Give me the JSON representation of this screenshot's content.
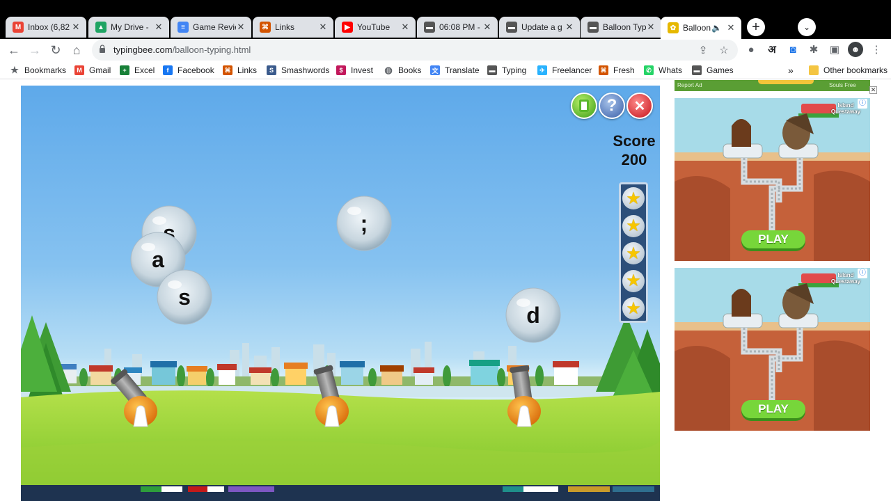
{
  "browser": {
    "tabs": [
      {
        "title": "Inbox (6,82",
        "icon": "gmail-icon",
        "color": "#ea4335",
        "glyph": "M",
        "active": false
      },
      {
        "title": "My Drive - ",
        "icon": "drive-icon",
        "color": "#1fa463",
        "glyph": "▲",
        "active": false
      },
      {
        "title": "Game Revie",
        "icon": "docs-icon",
        "color": "#4285f4",
        "glyph": "≡",
        "active": false
      },
      {
        "title": "Links",
        "icon": "links-icon",
        "color": "#d35400",
        "glyph": "⌘",
        "active": false
      },
      {
        "title": "YouTube",
        "icon": "youtube-icon",
        "color": "#ff0000",
        "glyph": "▶",
        "active": false
      },
      {
        "title": "06:08 PM - ",
        "icon": "typing-icon",
        "color": "#555555",
        "glyph": "▬",
        "active": false
      },
      {
        "title": "Update a g",
        "icon": "typing-icon",
        "color": "#555555",
        "glyph": "▬",
        "active": false
      },
      {
        "title": "Balloon Typ",
        "icon": "typing-icon",
        "color": "#555555",
        "glyph": "▬",
        "active": false
      },
      {
        "title": "Balloon",
        "icon": "typingbee-icon",
        "color": "#e6b800",
        "glyph": "✿",
        "active": true
      }
    ],
    "url_host": "typingbee.com",
    "url_path": "/balloon-typing.html",
    "bookmarks": [
      {
        "label": "Bookmarks",
        "icon": "star-icon",
        "color": "#5f6368",
        "glyph": "★"
      },
      {
        "label": "Gmail",
        "icon": "gmail-icon",
        "color": "#ea4335",
        "glyph": "M"
      },
      {
        "label": "Excel",
        "icon": "sheets-icon",
        "color": "#188038",
        "glyph": "+"
      },
      {
        "label": "Facebook",
        "icon": "facebook-icon",
        "color": "#1877f2",
        "glyph": "f"
      },
      {
        "label": "Links",
        "icon": "links-icon",
        "color": "#d35400",
        "glyph": "⌘"
      },
      {
        "label": "Smashwords",
        "icon": "smashwords-icon",
        "color": "#3b5b8c",
        "glyph": "S"
      },
      {
        "label": "Invest",
        "icon": "invest-icon",
        "color": "#c2185b",
        "glyph": "$"
      },
      {
        "label": "Books",
        "icon": "globe-icon",
        "color": "#5f6368",
        "glyph": "◍"
      },
      {
        "label": "Translate",
        "icon": "translate-icon",
        "color": "#4285f4",
        "glyph": "文"
      },
      {
        "label": "Typing",
        "icon": "typing-icon",
        "color": "#555555",
        "glyph": "▬"
      },
      {
        "label": "Freelancer",
        "icon": "freelancer-icon",
        "color": "#29b2fe",
        "glyph": "✈"
      },
      {
        "label": "Fresh",
        "icon": "fresh-icon",
        "color": "#d35400",
        "glyph": "⌘"
      },
      {
        "label": "Whats",
        "icon": "whatsapp-icon",
        "color": "#25d366",
        "glyph": "✆"
      },
      {
        "label": "Games",
        "icon": "typing-icon",
        "color": "#555555",
        "glyph": "▬"
      }
    ],
    "more_bookmarks": "»",
    "other_bookmarks": "Other bookmarks"
  },
  "game": {
    "score_label": "Score",
    "score_value": "200",
    "stars_remaining": 5,
    "balloons": [
      {
        "letter": "s"
      },
      {
        "letter": "a"
      },
      {
        "letter": "s"
      },
      {
        "letter": ";"
      },
      {
        "letter": "d"
      }
    ],
    "buttons": {
      "pause": "pause-icon",
      "help": "?",
      "close": "✕"
    }
  },
  "ads": {
    "brand": "Island Questaway",
    "play_label": "PLAY",
    "top_strip_left": "Report Ad",
    "top_strip_right": "Souls Free"
  }
}
